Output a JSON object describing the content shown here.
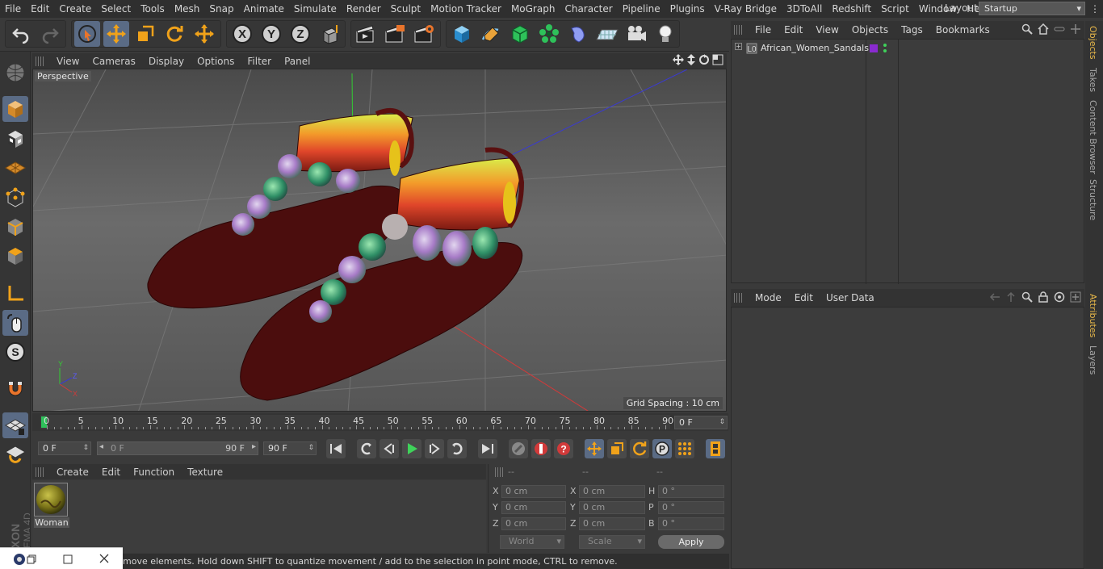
{
  "menubar": {
    "items": [
      "File",
      "Edit",
      "Create",
      "Select",
      "Tools",
      "Mesh",
      "Snap",
      "Animate",
      "Simulate",
      "Render",
      "Sculpt",
      "Motion Tracker",
      "MoGraph",
      "Character",
      "Pipeline",
      "Plugins",
      "V-Ray Bridge",
      "3DToAll",
      "Redshift",
      "Script",
      "Window",
      "Help"
    ],
    "layout_label": "Layout:",
    "layout_value": "Startup"
  },
  "viewport": {
    "menu": [
      "View",
      "Cameras",
      "Display",
      "Options",
      "Filter",
      "Panel"
    ],
    "camera_label": "Perspective",
    "grid_spacing": "Grid Spacing : 10 cm"
  },
  "timeline": {
    "ticks": [
      "0",
      "5",
      "10",
      "15",
      "20",
      "25",
      "30",
      "35",
      "40",
      "45",
      "50",
      "55",
      "60",
      "65",
      "70",
      "75",
      "80",
      "85",
      "90"
    ],
    "current_frame": "0 F",
    "start_frame": "0 F",
    "range_start": "0 F",
    "range_end": "90 F",
    "end_frame": "90 F"
  },
  "materials": {
    "menu": [
      "Create",
      "Edit",
      "Function",
      "Texture"
    ],
    "items": [
      {
        "name": "Woman"
      }
    ]
  },
  "coords": {
    "headers": [
      "--",
      "--",
      "--"
    ],
    "rows": [
      {
        "l1": "X",
        "v1": "0 cm",
        "l2": "X",
        "v2": "0 cm",
        "l3": "H",
        "v3": "0 °"
      },
      {
        "l1": "Y",
        "v1": "0 cm",
        "l2": "Y",
        "v2": "0 cm",
        "l3": "P",
        "v3": "0 °"
      },
      {
        "l1": "Z",
        "v1": "0 cm",
        "l2": "Z",
        "v2": "0 cm",
        "l3": "B",
        "v3": "0 °"
      }
    ],
    "world": "World",
    "scale": "Scale",
    "apply": "Apply"
  },
  "status": {
    "text": "move elements. Hold down SHIFT to quantize movement / add to the selection in point mode, CTRL to remove."
  },
  "objects": {
    "menu": [
      "File",
      "Edit",
      "View",
      "Objects",
      "Tags",
      "Bookmarks"
    ],
    "items": [
      {
        "name": "African_Women_Sandals",
        "color": "#8a2bd0"
      }
    ]
  },
  "attributes": {
    "menu": [
      "Mode",
      "Edit",
      "User Data"
    ]
  },
  "sidetabs": [
    "Objects",
    "Takes",
    "Content Browser",
    "Structure",
    "Attributes",
    "Layers"
  ],
  "brand": {
    "line1": "MAXON",
    "line2": "CINEMA 4D"
  },
  "colors": {
    "selected_tool": "#5a6b85",
    "accent_tab": "#e8b84a"
  }
}
